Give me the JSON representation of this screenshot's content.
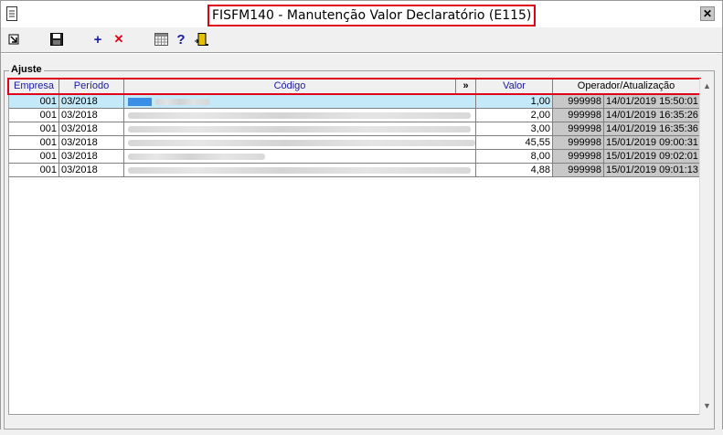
{
  "window": {
    "title": "FISFM140 - Manutenção Valor Declaratório (E115)",
    "close_glyph": "✕"
  },
  "toolbar": {
    "buttons": [
      {
        "name": "exit-arrow-icon"
      },
      {
        "name": "save-icon"
      },
      {
        "name": "add-icon",
        "glyph": "+"
      },
      {
        "name": "delete-icon",
        "glyph": "✕"
      },
      {
        "name": "calendar-icon"
      },
      {
        "name": "help-icon",
        "glyph": "?"
      },
      {
        "name": "door-exit-icon"
      }
    ]
  },
  "group": {
    "label": "Ajuste"
  },
  "grid": {
    "columns": {
      "empresa": "Empresa",
      "periodo": "Período",
      "codigo": "Código",
      "expand": "»",
      "valor": "Valor",
      "operador": "Operador/Atualização"
    },
    "rows": [
      {
        "empresa": "001",
        "periodo": "03/2018",
        "valor": "1,00",
        "operador": "999998",
        "atualizacao": "14/01/2019 15:50:01",
        "selected": true
      },
      {
        "empresa": "001",
        "periodo": "03/2018",
        "valor": "2,00",
        "operador": "999998",
        "atualizacao": "14/01/2019 16:35:26"
      },
      {
        "empresa": "001",
        "periodo": "03/2018",
        "valor": "3,00",
        "operador": "999998",
        "atualizacao": "14/01/2019 16:35:36"
      },
      {
        "empresa": "001",
        "periodo": "03/2018",
        "valor": "45,55",
        "operador": "999998",
        "atualizacao": "15/01/2019 09:00:31"
      },
      {
        "empresa": "001",
        "periodo": "03/2018",
        "valor": "8,00",
        "operador": "999998",
        "atualizacao": "15/01/2019 09:02:01"
      },
      {
        "empresa": "001",
        "periodo": "03/2018",
        "valor": "4,88",
        "operador": "999998",
        "atualizacao": "15/01/2019 09:01:13"
      }
    ]
  },
  "colors": {
    "highlight_border": "#e0001a",
    "header_text": "#1a1aa0",
    "selected_row": "#c4eaf9",
    "readonly_cell": "#c8c8c8"
  }
}
